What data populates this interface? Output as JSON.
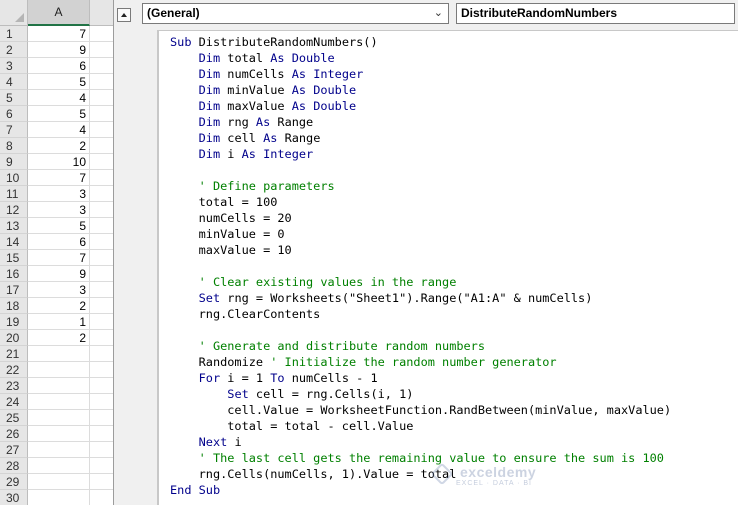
{
  "sheet": {
    "column_header": "A",
    "rows": [
      {
        "n": "1",
        "v": "7"
      },
      {
        "n": "2",
        "v": "9"
      },
      {
        "n": "3",
        "v": "6"
      },
      {
        "n": "4",
        "v": "5"
      },
      {
        "n": "5",
        "v": "4"
      },
      {
        "n": "6",
        "v": "5"
      },
      {
        "n": "7",
        "v": "4"
      },
      {
        "n": "8",
        "v": "2"
      },
      {
        "n": "9",
        "v": "10"
      },
      {
        "n": "10",
        "v": "7"
      },
      {
        "n": "11",
        "v": "3"
      },
      {
        "n": "12",
        "v": "3"
      },
      {
        "n": "13",
        "v": "5"
      },
      {
        "n": "14",
        "v": "6"
      },
      {
        "n": "15",
        "v": "7"
      },
      {
        "n": "16",
        "v": "9"
      },
      {
        "n": "17",
        "v": "3"
      },
      {
        "n": "18",
        "v": "2"
      },
      {
        "n": "19",
        "v": "1"
      },
      {
        "n": "20",
        "v": "2"
      },
      {
        "n": "21",
        "v": ""
      },
      {
        "n": "22",
        "v": ""
      },
      {
        "n": "23",
        "v": ""
      },
      {
        "n": "24",
        "v": ""
      },
      {
        "n": "25",
        "v": ""
      },
      {
        "n": "26",
        "v": ""
      },
      {
        "n": "27",
        "v": ""
      },
      {
        "n": "28",
        "v": ""
      },
      {
        "n": "29",
        "v": ""
      },
      {
        "n": "30",
        "v": ""
      }
    ]
  },
  "editor": {
    "object_combo": "(General)",
    "procedure_combo": "DistributeRandomNumbers",
    "dropdown_glyph": "⌄",
    "code_lines": [
      [
        [
          "kw",
          "Sub "
        ],
        [
          "tx",
          "DistributeRandomNumbers()"
        ]
      ],
      [
        [
          "tx",
          "    "
        ],
        [
          "kw",
          "Dim "
        ],
        [
          "tx",
          "total "
        ],
        [
          "kw",
          "As Double"
        ]
      ],
      [
        [
          "tx",
          "    "
        ],
        [
          "kw",
          "Dim "
        ],
        [
          "tx",
          "numCells "
        ],
        [
          "kw",
          "As Integer"
        ]
      ],
      [
        [
          "tx",
          "    "
        ],
        [
          "kw",
          "Dim "
        ],
        [
          "tx",
          "minValue "
        ],
        [
          "kw",
          "As Double"
        ]
      ],
      [
        [
          "tx",
          "    "
        ],
        [
          "kw",
          "Dim "
        ],
        [
          "tx",
          "maxValue "
        ],
        [
          "kw",
          "As Double"
        ]
      ],
      [
        [
          "tx",
          "    "
        ],
        [
          "kw",
          "Dim "
        ],
        [
          "tx",
          "rng "
        ],
        [
          "kw",
          "As "
        ],
        [
          "tx",
          "Range"
        ]
      ],
      [
        [
          "tx",
          "    "
        ],
        [
          "kw",
          "Dim "
        ],
        [
          "tx",
          "cell "
        ],
        [
          "kw",
          "As "
        ],
        [
          "tx",
          "Range"
        ]
      ],
      [
        [
          "tx",
          "    "
        ],
        [
          "kw",
          "Dim "
        ],
        [
          "tx",
          "i "
        ],
        [
          "kw",
          "As Integer"
        ]
      ],
      [],
      [
        [
          "tx",
          "    "
        ],
        [
          "cm",
          "' Define parameters"
        ]
      ],
      [
        [
          "tx",
          "    total = 100"
        ]
      ],
      [
        [
          "tx",
          "    numCells = 20"
        ]
      ],
      [
        [
          "tx",
          "    minValue = 0"
        ]
      ],
      [
        [
          "tx",
          "    maxValue = 10"
        ]
      ],
      [],
      [
        [
          "tx",
          "    "
        ],
        [
          "cm",
          "' Clear existing values in the range"
        ]
      ],
      [
        [
          "tx",
          "    "
        ],
        [
          "kw",
          "Set "
        ],
        [
          "tx",
          "rng = Worksheets(\"Sheet1\").Range(\"A1:A\" & numCells)"
        ]
      ],
      [
        [
          "tx",
          "    rng.ClearContents"
        ]
      ],
      [],
      [
        [
          "tx",
          "    "
        ],
        [
          "cm",
          "' Generate and distribute random numbers"
        ]
      ],
      [
        [
          "tx",
          "    Randomize "
        ],
        [
          "cm",
          "' Initialize the random number generator"
        ]
      ],
      [
        [
          "tx",
          "    "
        ],
        [
          "kw",
          "For "
        ],
        [
          "tx",
          "i = 1 "
        ],
        [
          "kw",
          "To "
        ],
        [
          "tx",
          "numCells - 1"
        ]
      ],
      [
        [
          "tx",
          "        "
        ],
        [
          "kw",
          "Set "
        ],
        [
          "tx",
          "cell = rng.Cells(i, 1)"
        ]
      ],
      [
        [
          "tx",
          "        cell.Value = WorksheetFunction.RandBetween(minValue, maxValue)"
        ]
      ],
      [
        [
          "tx",
          "        total = total - cell.Value"
        ]
      ],
      [
        [
          "tx",
          "    "
        ],
        [
          "kw",
          "Next "
        ],
        [
          "tx",
          "i"
        ]
      ],
      [
        [
          "tx",
          "    "
        ],
        [
          "cm",
          "' The last cell gets the remaining value to ensure the sum is 100"
        ]
      ],
      [
        [
          "tx",
          "    rng.Cells(numCells, 1).Value = total"
        ]
      ],
      [
        [
          "kw",
          "End Sub"
        ]
      ]
    ]
  },
  "watermark": {
    "name": "exceldemy",
    "tagline": "EXCEL · DATA · BI"
  },
  "colors": {
    "keyword": "#00008b",
    "comment": "#008000",
    "selected_column_accent": "#217346"
  }
}
